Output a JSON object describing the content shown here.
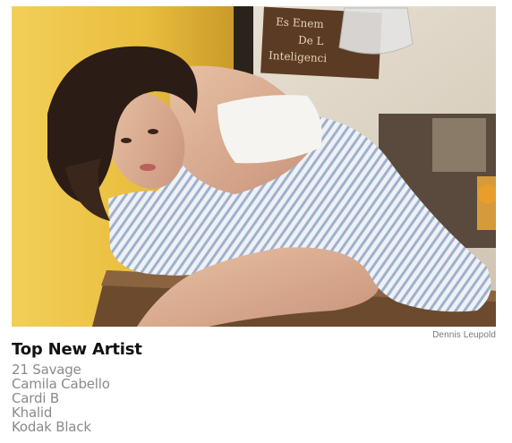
{
  "photo": {
    "alt": "",
    "credit": "Dennis Leupold",
    "sign_lines": [
      "Es Enem",
      "De L",
      "Inteligenci"
    ]
  },
  "section": {
    "title": "Top New Artist",
    "artists": [
      "21 Savage",
      "Camila Cabello",
      "Cardi B",
      "Khalid",
      "Kodak Black"
    ]
  }
}
